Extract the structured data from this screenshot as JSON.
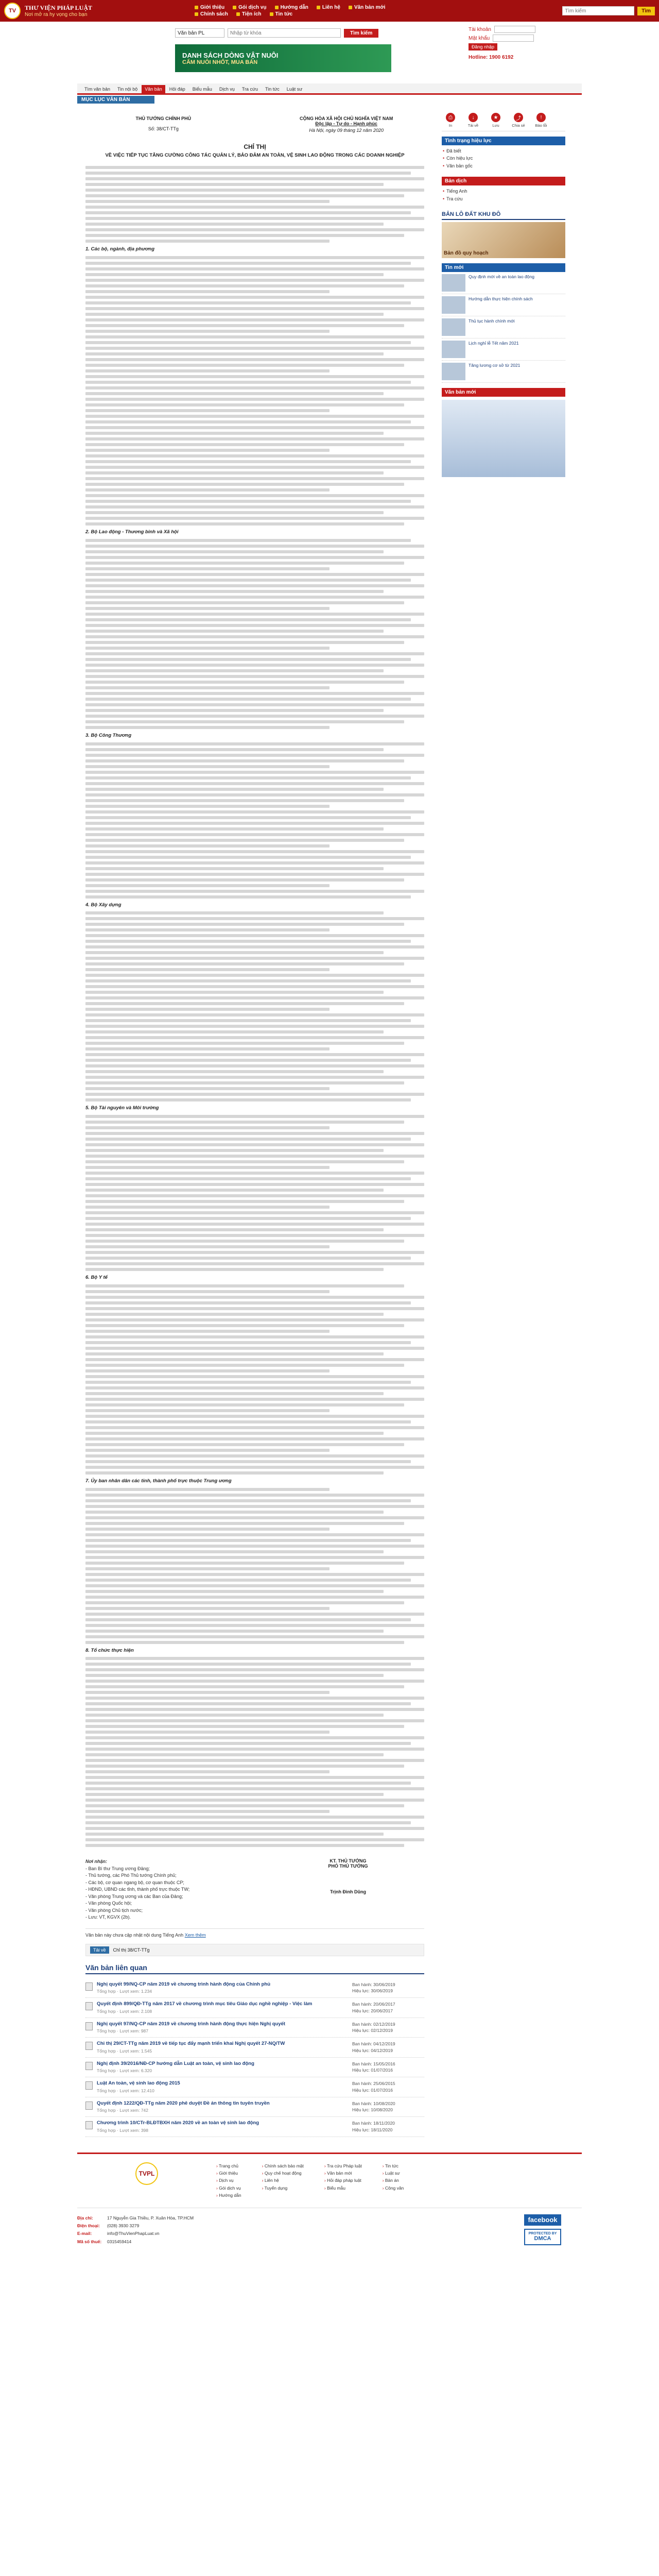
{
  "header": {
    "logo_line1": "THƯ VIỆN PHÁP LUẬT",
    "logo_line2": "Nơi mở ra hy vọng cho bạn",
    "top_links": [
      "Giới thiệu",
      "Gói dịch vụ",
      "Hướng dẫn",
      "Liên hệ",
      "Văn bản mới",
      "Chính sách",
      "Tiện ích",
      "Tin tức"
    ],
    "search_placeholder": "Tìm kiếm",
    "search_button": "Tìm"
  },
  "search": {
    "select_value": "Văn bản PL",
    "input_placeholder": "Nhập từ khóa",
    "button": "Tìm kiếm"
  },
  "banner": {
    "line1": "DANH SÁCH DÒNG VẬT NUÔI",
    "line2": "CẤM NUÔI NHỐT, MUA BÁN"
  },
  "login": {
    "label_user": "Tài khoản",
    "label_pass": "Mật khẩu",
    "button": "Đăng nhập",
    "hotline": "Hotline: 1900 6192"
  },
  "nav": {
    "tabs": [
      "Tìm văn bản",
      "Tin nội bộ",
      "Văn bản",
      "Hỏi đáp",
      "Biểu mẫu",
      "Dịch vụ",
      "Tra cứu",
      "Tin tức",
      "Luật sư"
    ],
    "active_index": 2,
    "breadcrumb": "MỤC LỤC VĂN BẢN"
  },
  "doc": {
    "issuer": "THỦ TƯỚNG CHÍNH PHỦ",
    "number": "Số: 38/CT-TTg",
    "country": "CỘNG HÒA XÃ HỘI CHỦ NGHĨA VIỆT NAM",
    "motto": "Độc lập - Tự do - Hạnh phúc",
    "date": "Hà Nội, ngày 09 tháng 12 năm 2020",
    "title": "CHỈ THỊ",
    "subtitle": "VỀ VIỆC TIẾP TỤC TĂNG CƯỜNG CÔNG TÁC QUẢN LÝ, BẢO ĐẢM AN TOÀN, VỆ SINH LAO ĐỘNG TRONG CÁC DOANH NGHIỆP",
    "section_heads": [
      "1. Các bộ, ngành, địa phương",
      "2. Bộ Lao động - Thương binh và Xã hội",
      "3. Bộ Công Thương",
      "4. Bộ Xây dựng",
      "5. Bộ Tài nguyên và Môi trường",
      "6. Bộ Y tế",
      "7. Ủy ban nhân dân các tỉnh, thành phố trực thuộc Trung ương",
      "8. Tổ chức thực hiện"
    ],
    "sig_role": "KT. THỦ TƯỚNG\nPHÓ THỦ TƯỚNG",
    "sig_name": "Trịnh Đình Dũng",
    "recipients_label": "Nơi nhận:",
    "recipients": [
      "- Ban Bí thư Trung ương Đảng;",
      "- Thủ tướng, các Phó Thủ tướng Chính phủ;",
      "- Các bộ, cơ quan ngang bộ, cơ quan thuộc CP;",
      "- HĐND, UBND các tỉnh, thành phố trực thuộc TW;",
      "- Văn phòng Trung ương và các Ban của Đảng;",
      "- Văn phòng Quốc hội;",
      "- Văn phòng Chủ tịch nước;",
      "- Lưu: VT, KGVX (2b)."
    ],
    "note": "Văn bản này chưa cập nhật nội dung Tiếng Anh",
    "note_link": "Xem thêm",
    "tools_button": "Tải về",
    "tools_text": "Chỉ thị 38/CT-TTg"
  },
  "related": {
    "title": "Văn bản liên quan",
    "items": [
      {
        "title": "Nghị quyết 99/NQ-CP năm 2019 về chương trình hành động của Chính phủ",
        "meta": "Tổng hợp · Lượt xem: 1.234",
        "dates": "Ban hành: 30/06/2019\nHiệu lực: 30/06/2019"
      },
      {
        "title": "Quyết định 899/QĐ-TTg năm 2017 về chương trình mục tiêu Giáo dục nghề nghiệp - Việc làm",
        "meta": "Tổng hợp · Lượt xem: 2.108",
        "dates": "Ban hành: 20/06/2017\nHiệu lực: 20/06/2017"
      },
      {
        "title": "Nghị quyết 97/NQ-CP năm 2019 về chương trình hành động thực hiện Nghị quyết",
        "meta": "Tổng hợp · Lượt xem: 987",
        "dates": "Ban hành: 02/12/2019\nHiệu lực: 02/12/2019"
      },
      {
        "title": "Chỉ thị 29/CT-TTg năm 2019 về tiếp tục đẩy mạnh triển khai Nghị quyết 27-NQ/TW",
        "meta": "Tổng hợp · Lượt xem: 1.545",
        "dates": "Ban hành: 04/12/2019\nHiệu lực: 04/12/2019"
      },
      {
        "title": "Nghị định 39/2016/NĐ-CP hướng dẫn Luật an toàn, vệ sinh lao động",
        "meta": "Tổng hợp · Lượt xem: 6.320",
        "dates": "Ban hành: 15/05/2016\nHiệu lực: 01/07/2016"
      },
      {
        "title": "Luật An toàn, vệ sinh lao động 2015",
        "meta": "Tổng hợp · Lượt xem: 12.410",
        "dates": "Ban hành: 25/06/2015\nHiệu lực: 01/07/2016"
      },
      {
        "title": "Quyết định 1222/QĐ-TTg năm 2020 phê duyệt Đề án thông tin tuyên truyền",
        "meta": "Tổng hợp · Lượt xem: 742",
        "dates": "Ban hành: 10/08/2020\nHiệu lực: 10/08/2020"
      },
      {
        "title": "Chương trình 10/CTr-BLĐTBXH năm 2020 về an toàn vệ sinh lao động",
        "meta": "Tổng hợp · Lượt xem: 398",
        "dates": "Ban hành: 18/11/2020\nHiệu lực: 18/11/2020"
      }
    ]
  },
  "sidebar": {
    "tools": [
      "In",
      "Tải về",
      "Lưu",
      "Chia sẻ",
      "Báo lỗi"
    ],
    "box1_title": "Tình trạng hiệu lực",
    "box1_items": [
      "Đã biết",
      "Còn hiệu lực",
      "Văn bản gốc"
    ],
    "box2_title": "Bản dịch",
    "box2_items": [
      "Tiếng Anh",
      "Tra cứu"
    ],
    "box3_title": "BẢN LÔ ĐẤT KHU ĐÔ",
    "box3_img": "Bản đồ quy hoạch",
    "box4_title": "Tin mới",
    "news": [
      "Quy định mới về an toàn lao động",
      "Hướng dẫn thực hiện chính sách",
      "Thủ tục hành chính mới",
      "Lịch nghỉ lễ Tết năm 2021",
      "Tăng lương cơ sở từ 2021"
    ],
    "box5_title": "Văn bản mới"
  },
  "footer": {
    "logo": "TVPL",
    "col1": [
      "Trang chủ",
      "Giới thiệu",
      "Dịch vụ",
      "Gói dịch vụ",
      "Hướng dẫn"
    ],
    "col2": [
      "Chính sách bảo mật",
      "Quy chế hoạt động",
      "Liên hệ",
      "Tuyển dụng"
    ],
    "col3": [
      "Tra cứu Pháp luật",
      "Văn bản mới",
      "Hỏi đáp pháp luật",
      "Biểu mẫu"
    ],
    "col4": [
      "Tin tức",
      "Luật sư",
      "Bản án",
      "Công văn"
    ],
    "address_label": "Địa chỉ:",
    "address": "17 Nguyễn Gia Thiều, P. Xuân Hòa, TP.HCM",
    "phone_label": "Điện thoại:",
    "phone": "(028) 3930 3279",
    "email_label": "E-mail:",
    "email": "info@ThuVienPhapLuat.vn",
    "license_label": "Mã số thuế:",
    "license": "0315459414",
    "social": "facebook",
    "dmca_top": "PROTECTED BY",
    "dmca_main": "DMCA"
  },
  "colors": {
    "brand_red": "#a20f0f",
    "accent_red": "#c41c1c",
    "link_blue": "#1d3f7a",
    "gold": "#f1c40f"
  }
}
